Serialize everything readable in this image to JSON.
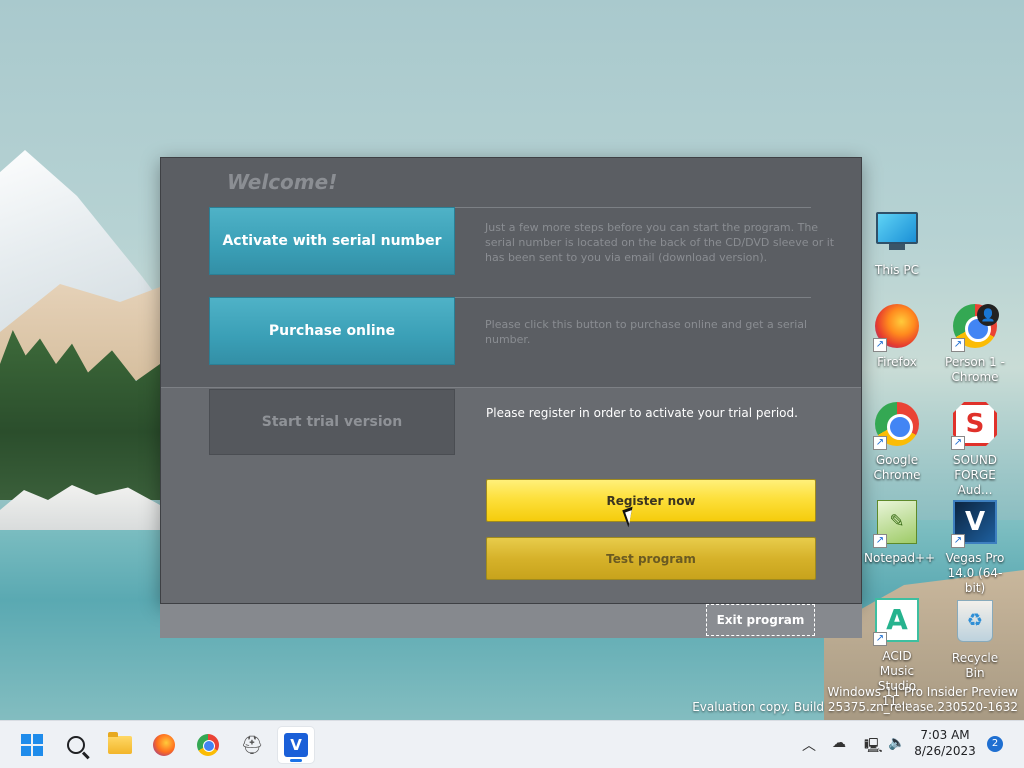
{
  "dialog": {
    "welcome": "Welcome!",
    "options": [
      {
        "label": "Activate with serial number",
        "description": "Just a few more steps before you can start the program. The serial number is located on the back of the CD/DVD sleeve or it has been sent to you via email (download version)."
      },
      {
        "label": "Purchase online",
        "description": "Please click this button to purchase online and get a serial number."
      },
      {
        "label": "Start trial version",
        "description": "Please register in order to activate your trial period."
      }
    ],
    "register_label": "Register now",
    "test_label": "Test program",
    "exit_label": "Exit program"
  },
  "desktop_icons": [
    {
      "label": "This PC",
      "icon": "monitor-icon"
    },
    {
      "label": "Firefox",
      "icon": "firefox-icon"
    },
    {
      "label": "Person 1 - Chrome",
      "icon": "chrome-profile-icon"
    },
    {
      "label": "Google Chrome",
      "icon": "chrome-icon"
    },
    {
      "label": "SOUND FORGE Aud...",
      "icon": "sound-forge-icon"
    },
    {
      "label": "Notepad++",
      "icon": "notepad-plus-plus-icon"
    },
    {
      "label": "Vegas Pro 14.0 (64-bit)",
      "icon": "vegas-pro-icon"
    },
    {
      "label": "ACID Music Studio 11....",
      "icon": "acid-music-icon"
    },
    {
      "label": "Recycle Bin",
      "icon": "recycle-bin-icon"
    }
  ],
  "watermark": {
    "line1": "Windows 11 Pro Insider Preview",
    "line2": "Evaluation copy. Build 25375.zn_release.230520-1632"
  },
  "taskbar": {
    "time": "7:03 AM",
    "date": "8/26/2023",
    "notification_count": "2"
  },
  "colors": {
    "accent_teal": "#3a9fb6",
    "register_yellow": "#fde03c",
    "dialog_bg": "#5b5e63"
  }
}
